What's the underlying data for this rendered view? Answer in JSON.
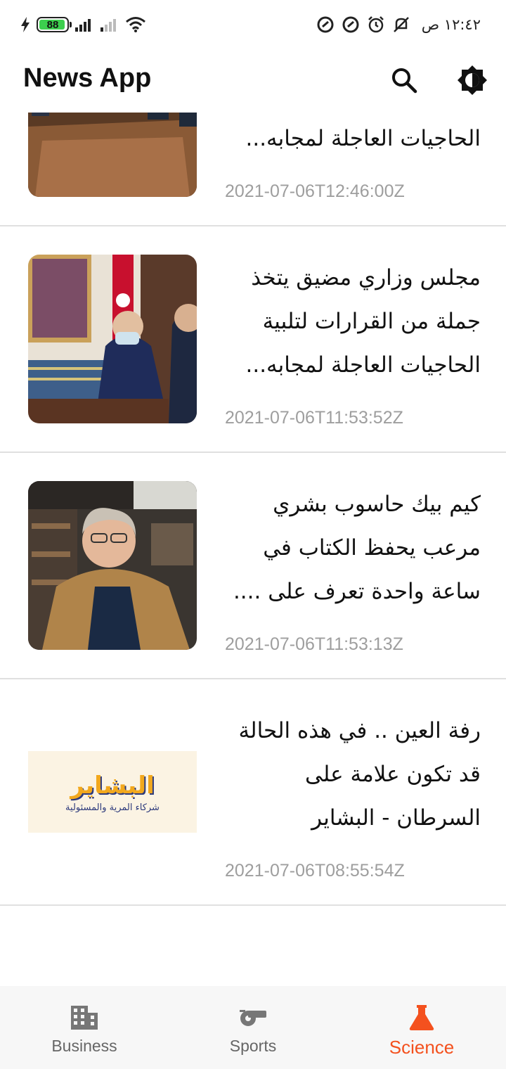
{
  "status_bar": {
    "battery": "88",
    "time": "١٢:٤٢ ص"
  },
  "app_bar": {
    "title": "News App",
    "search_icon": "search-icon",
    "theme_icon": "brightness-icon"
  },
  "articles": [
    {
      "title": "مجلس وزاري مضيق يتخذ جملة من القرارات لتلبية الحاجيات العاجلة لمجابه...",
      "date": "2021-07-06T12:46:00Z",
      "thumbnail": "cabinet-meeting-photo"
    },
    {
      "title": "مجلس وزاري مضيق يتخذ جملة من القرارات لتلبية الحاجيات العاجلة لمجابه...",
      "date": "2021-07-06T11:53:52Z",
      "thumbnail": "minister-speaking-photo"
    },
    {
      "title": "كيم بيك حاسوب بشري مرعب يحفظ الكتاب في ساعة واحدة تعرف على ....",
      "date": "2021-07-06T11:53:13Z",
      "thumbnail": "man-in-library-photo"
    },
    {
      "title": "رفة العين .. في هذه الحالة قد تكون علامة على السرطان - البشاير",
      "date": "2021-07-06T08:55:54Z",
      "thumbnail": "albashayer-logo",
      "logo_text": "البشاير",
      "logo_subtext": "شركاء المرية والمسئولية"
    }
  ],
  "bottom_nav": [
    {
      "label": "Business",
      "icon": "building-icon",
      "active": false
    },
    {
      "label": "Sports",
      "icon": "whistle-icon",
      "active": false
    },
    {
      "label": "Science",
      "icon": "flask-icon",
      "active": true
    }
  ],
  "colors": {
    "accent": "#f4511e",
    "inactive": "#666666",
    "date": "#9e9e9e",
    "divider": "#e0e0e0"
  }
}
